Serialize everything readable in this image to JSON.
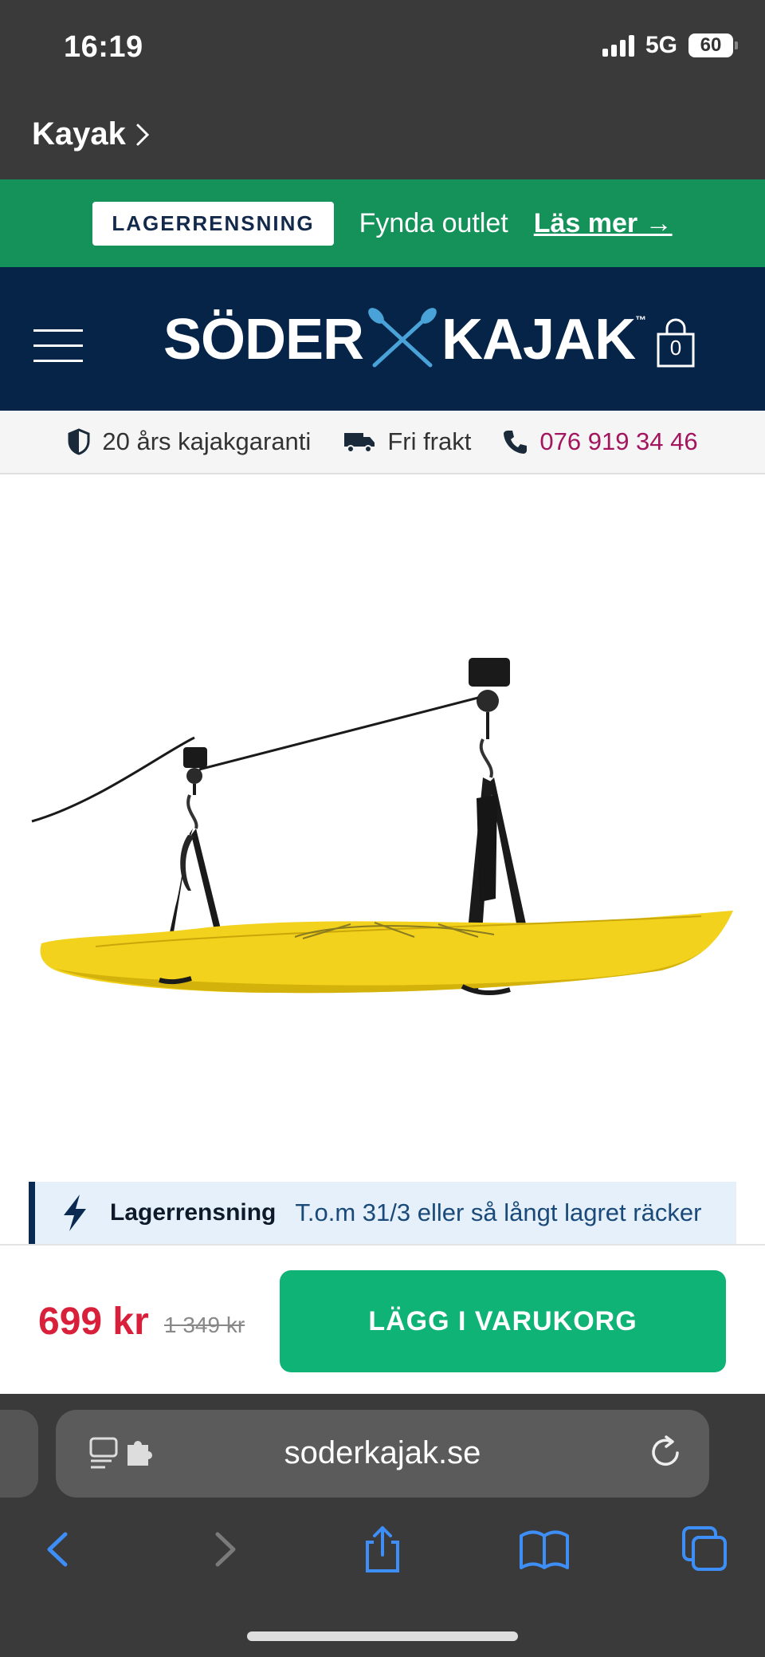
{
  "status_bar": {
    "time": "16:19",
    "network": "5G",
    "battery": "60"
  },
  "nav": {
    "breadcrumb": "Kayak"
  },
  "promo": {
    "badge": "LAGERRENSNING",
    "text": "Fynda outlet",
    "link": "Läs mer →"
  },
  "header": {
    "logo_left": "SÖDER",
    "logo_right": "KAJAK",
    "logo_tm": "™",
    "cart_count": "0"
  },
  "usp": {
    "warranty": "20 års kajakgaranti",
    "shipping": "Fri frakt",
    "phone": "076 919 34 46"
  },
  "banner": {
    "title": "Lagerrensning",
    "text": "T.o.m 31/3 eller så långt lagret räcker"
  },
  "product": {
    "price": "699 kr",
    "old_price": "1 349 kr",
    "add_to_cart": "LÄGG I VARUKORG"
  },
  "browser": {
    "url": "soderkajak.se"
  },
  "colors": {
    "promo_green": "#15925a",
    "header_navy": "#062348",
    "price_red": "#d8203a",
    "cta_green": "#0fb376",
    "phone_magenta": "#a3165f"
  },
  "icons": [
    "chevron-right-icon",
    "menu-icon",
    "cart-icon",
    "shield-icon",
    "truck-icon",
    "phone-icon",
    "lightning-icon",
    "reader-icon",
    "reload-icon",
    "back-icon",
    "forward-icon",
    "share-icon",
    "bookmarks-icon",
    "tabs-icon"
  ]
}
